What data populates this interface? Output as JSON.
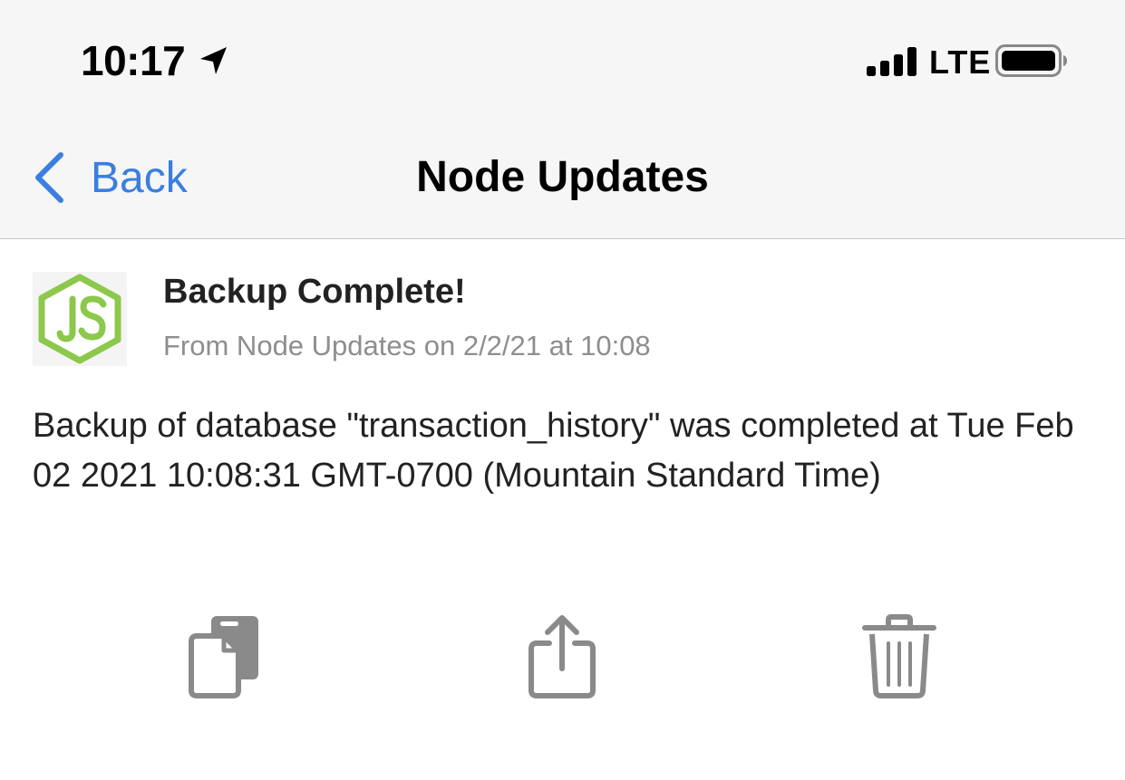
{
  "status_bar": {
    "time": "10:17",
    "location_icon": "location-arrow-icon",
    "signal_icon": "cellular-signal-icon",
    "network": "LTE",
    "battery_icon": "battery-icon"
  },
  "nav_bar": {
    "back_label": "Back",
    "title": "Node Updates",
    "accent_color": "#3a7fe0"
  },
  "message": {
    "app_icon": "nodejs-logo-icon",
    "title": "Backup Complete!",
    "meta": "From Node Updates on 2/2/21 at 10:08",
    "body": "Backup of database \"transaction_history\" was completed at Tue Feb 02 2021 10:08:31 GMT-0700 (Mountain Standard Time)"
  },
  "actions": {
    "copy_icon": "copy-icon",
    "share_icon": "share-icon",
    "trash_icon": "trash-icon"
  }
}
